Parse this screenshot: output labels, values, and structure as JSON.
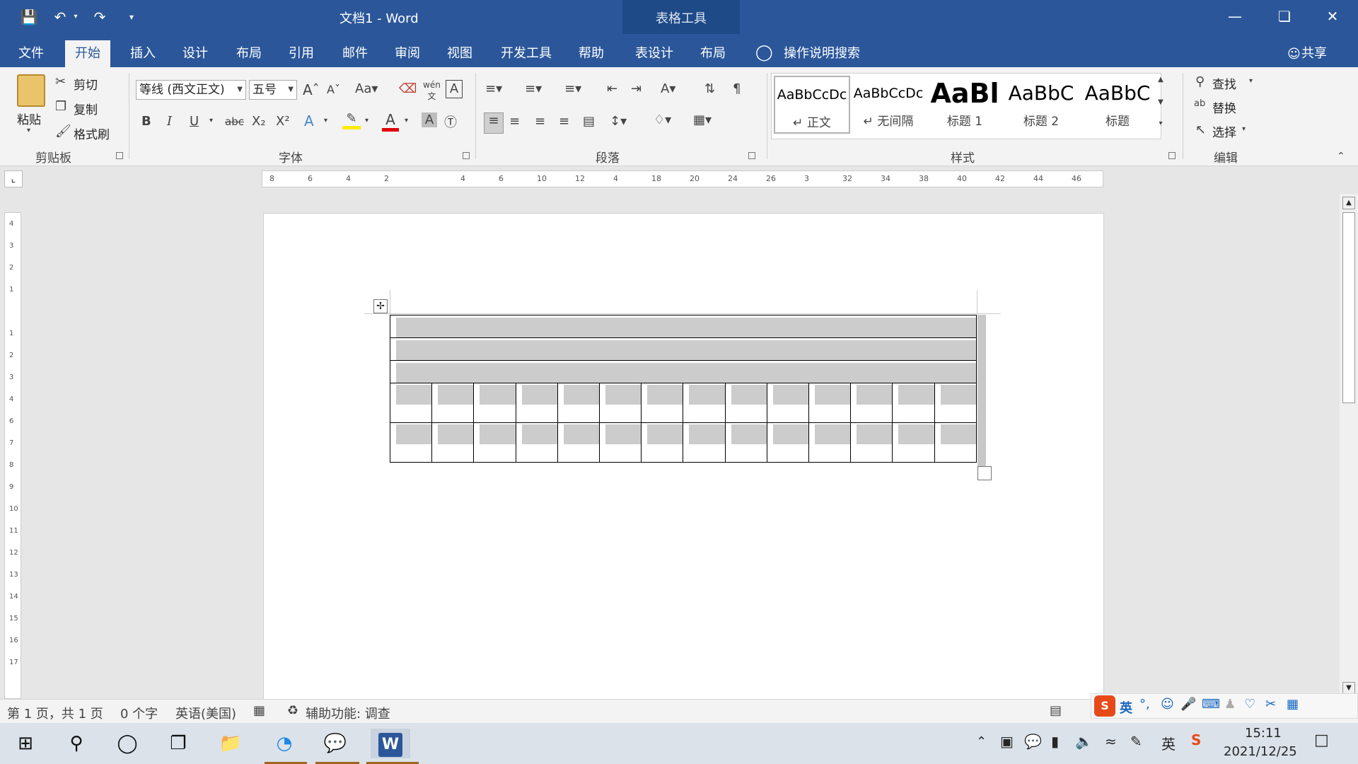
{
  "titlebar": {
    "doc_title": "文档1  -  Word",
    "context_label": "表格工具"
  },
  "tabs": [
    "文件",
    "开始",
    "插入",
    "设计",
    "布局",
    "引用",
    "邮件",
    "审阅",
    "视图",
    "开发工具",
    "帮助",
    "表设计",
    "布局"
  ],
  "tell_me": "操作说明搜索",
  "share": "共享",
  "clipboard": {
    "paste": "粘贴",
    "cut": "剪切",
    "copy": "复制",
    "format_painter": "格式刷",
    "label": "剪贴板"
  },
  "font": {
    "name": "等线 (西文正文)",
    "size": "五号",
    "label": "字体"
  },
  "paragraph": {
    "label": "段落"
  },
  "styles": {
    "label": "样式",
    "items": [
      {
        "preview": "AaBbCcDc",
        "name": "↵ 正文"
      },
      {
        "preview": "AaBbCcDc",
        "name": "↵ 无间隔"
      },
      {
        "preview": "AaBl",
        "name": "标题 1"
      },
      {
        "preview": "AaBbC",
        "name": "标题 2"
      },
      {
        "preview": "AaBbC",
        "name": "标题"
      }
    ]
  },
  "editing": {
    "find": "查找",
    "replace": "替换",
    "select": "选择",
    "label": "编辑"
  },
  "hruler_labels": [
    "8",
    "6",
    "4",
    "2",
    "",
    "4",
    "6",
    "10",
    "12",
    "4",
    "18",
    "20",
    "24",
    "26",
    "3",
    "32",
    "34",
    "38",
    "40",
    "42",
    "44",
    "46"
  ],
  "vruler_labels": [
    "4",
    "3",
    "2",
    "1",
    "",
    "1",
    "2",
    "3",
    "4",
    "6",
    "7",
    "8",
    "9",
    "10",
    "11",
    "12",
    "13",
    "14",
    "15",
    "16",
    "17"
  ],
  "table": {
    "merged_rows": 3,
    "split_rows": 2,
    "split_cols": 14
  },
  "status": {
    "page": "第 1 页，共 1 页",
    "words": "0 个字",
    "language": "英语(美国)",
    "accessibility": "辅助功能: 调查"
  },
  "ime": {
    "mode": "英"
  },
  "clock": {
    "time": "15:11",
    "date": "2021/12/25"
  },
  "tray": {
    "ime_char": "英"
  },
  "colors": {
    "accent": "#2b579a",
    "context": "#1e4a87"
  }
}
